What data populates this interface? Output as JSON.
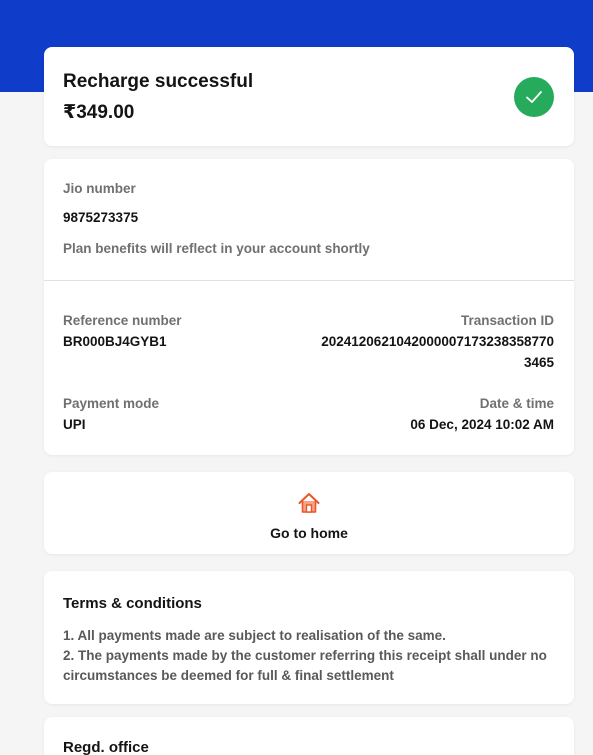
{
  "status": {
    "title": "Recharge successful",
    "amount": "₹349.00",
    "icon": "check-icon",
    "accent": "#25ab5b"
  },
  "details": {
    "number_label": "Jio number",
    "number_value": "9875273375",
    "note": "Plan benefits will reflect in your account shortly",
    "reference_label": "Reference number",
    "reference_value": "BR000BJ4GYB1",
    "transaction_label": "Transaction ID",
    "transaction_value_line1": "202412062104200000717323835877​0",
    "transaction_value_line2": "3465",
    "payment_mode_label": "Payment mode",
    "payment_mode_value": "UPI",
    "datetime_label": "Date & time",
    "datetime_value": "06 Dec, 2024 10:02 AM"
  },
  "home": {
    "label": "Go to home",
    "icon": "home-icon"
  },
  "terms": {
    "title": "Terms & conditions",
    "items": [
      "1. All payments made are subject to realisation of the same.",
      "2. The payments made by the customer referring this receipt shall under no circumstances be deemed for full & final settlement"
    ]
  },
  "office": {
    "title": "Regd. office"
  },
  "colors": {
    "brand_blue": "#0f3cc9",
    "success_green": "#25ab5b",
    "home_icon_orange": "#e8562a"
  }
}
